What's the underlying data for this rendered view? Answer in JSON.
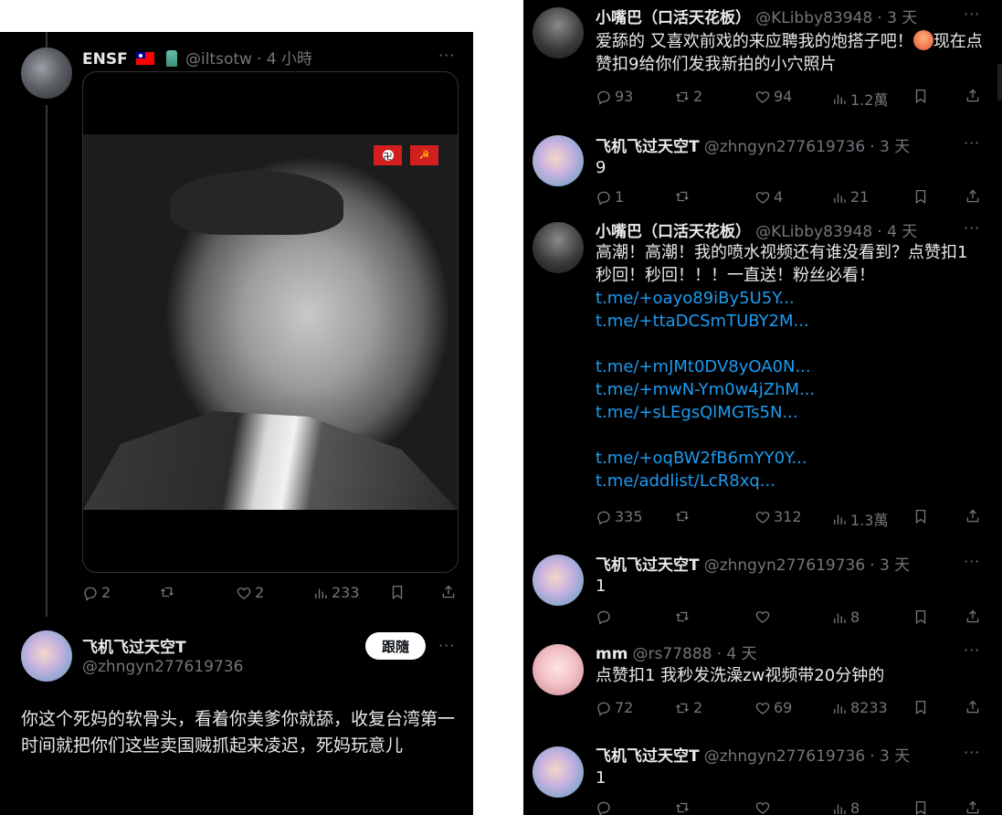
{
  "left": {
    "post": {
      "name": "ENSF",
      "handle": "@iltsotw",
      "time": "· 4 小時",
      "more": "···",
      "avatar_icon": "rooftop-photo-avatar",
      "media_icons": [
        "nazi-flag-icon",
        "communist-flag-icon"
      ],
      "actions": {
        "replies": "2",
        "reposts": "",
        "likes": "2",
        "views": "233"
      }
    },
    "reply": {
      "name": "飞机飞过天空T",
      "handle": "@zhngyn277619736",
      "follow_label": "跟隨",
      "more": "···",
      "text": "你这个死妈的软骨头，看着你美爹你就舔，收复台湾第一时间就把你们这些卖国贼抓起来凌迟，死妈玩意儿"
    }
  },
  "right": {
    "posts": [
      {
        "name": "小嘴巴（口活天花板）",
        "handle": "@KLibby83948",
        "time": "· 3 天",
        "text": "爱舔的 又喜欢前戏的来应聘我的炮搭子吧！",
        "text_tail": "现在点赞扣9给你们发我新拍的小穴照片",
        "actions": {
          "replies": "93",
          "reposts": "2",
          "likes": "94",
          "views": "1.2萬"
        }
      },
      {
        "name": "飞机飞过天空T",
        "handle": "@zhngyn277619736",
        "time": "· 3 天",
        "text": "9",
        "actions": {
          "replies": "1",
          "reposts": "",
          "likes": "4",
          "views": "21"
        }
      },
      {
        "name": "小嘴巴（口活天花板）",
        "handle": "@KLibby83948",
        "time": "· 4 天",
        "text": "高潮！高潮！我的喷水视频还有谁没看到？点赞扣1 秒回！秒回！！！一直送！粉丝必看！",
        "links_a": [
          "t.me/+oayo89iBy5U5Y...",
          "t.me/+ttaDCSmTUBY2M..."
        ],
        "links_b": [
          "t.me/+mJMt0DV8yOA0N...",
          "t.me/+mwN-Ym0w4jZhM...",
          "t.me/+sLEgsQlMGTs5N..."
        ],
        "links_c": [
          "t.me/+oqBW2fB6mYY0Y...",
          "t.me/addlist/LcR8xq..."
        ],
        "actions": {
          "replies": "335",
          "reposts": "",
          "likes": "312",
          "views": "1.3萬"
        }
      },
      {
        "name": "飞机飞过天空T",
        "handle": "@zhngyn277619736",
        "time": "· 3 天",
        "text": "1",
        "actions": {
          "replies": "",
          "reposts": "",
          "likes": "",
          "views": "8"
        }
      },
      {
        "name": "mm",
        "handle": "@rs77888",
        "time": "· 4 天",
        "text": "点赞扣1 我秒发洗澡zw视频带20分钟的",
        "actions": {
          "replies": "72",
          "reposts": "2",
          "likes": "69",
          "views": "8233"
        }
      },
      {
        "name": "飞机飞过天空T",
        "handle": "@zhngyn277619736",
        "time": "· 3 天",
        "text": "1",
        "actions": {
          "replies": "",
          "reposts": "",
          "likes": "",
          "views": "8"
        }
      }
    ],
    "more": "···"
  },
  "colors": {
    "bg": "#000000",
    "text": "#e7e9ea",
    "muted": "#71767b",
    "link": "#1d9bf0",
    "border": "#2f3336"
  }
}
